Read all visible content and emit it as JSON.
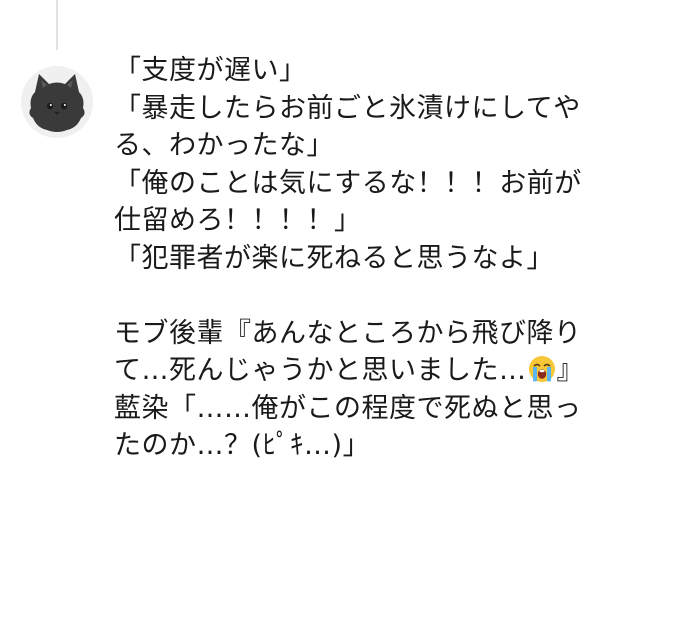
{
  "post": {
    "lines": [
      "「支度が遅い」",
      "「暴走したらお前ごと氷漬けにしてや",
      "る、わかったな」",
      "「俺のことは気にするな！！！お前が",
      "仕留めろ！！！！」",
      "「犯罪者が楽に死ねると思うなよ」",
      "",
      "モブ後輩『あんなところから飛び降り",
      "て…死んじゃうかと思いました…",
      "』",
      "藍染「……俺がこの程度で死ぬと思っ",
      "たのか…？(ﾋﾟｷ…)」"
    ],
    "emoji_name": "loudly-crying-face-emoji"
  }
}
